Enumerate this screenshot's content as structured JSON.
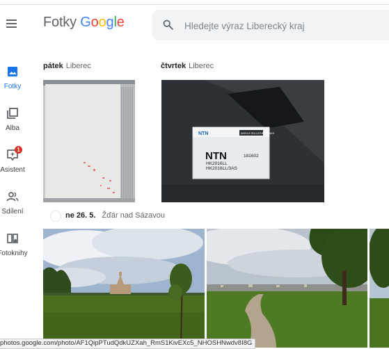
{
  "app": {
    "brand": "Fotky",
    "logo_letters": [
      "G",
      "o",
      "o",
      "g",
      "l",
      "e"
    ]
  },
  "search": {
    "placeholder": "Hledejte výraz Liberecký kraj"
  },
  "sidebar": {
    "items": [
      {
        "label": "Fotky",
        "icon": "photos-icon",
        "active": true
      },
      {
        "label": "Alba",
        "icon": "albums-icon"
      },
      {
        "label": "Asistent",
        "icon": "assistant-icon",
        "badge": "1"
      },
      {
        "label": "Sdílení",
        "icon": "sharing-icon"
      },
      {
        "label": "Fotoknihy",
        "icon": "photobook-icon"
      }
    ]
  },
  "sections": [
    {
      "day": "pátek",
      "place": "Liberec"
    },
    {
      "day": "čtvrtek",
      "place": "Liberec"
    },
    {
      "day": "ne 26. 5.",
      "place": "Žďár nad Sázavou"
    }
  ],
  "photo_text": {
    "box_brand": "NTN",
    "box_code": "181602",
    "box_model_1": "HK2016LL",
    "box_model_2": "HK2016LL/3AS",
    "box_label": "NEEDLE ROLLER BEARINGS"
  },
  "status": {
    "url": "photos.google.com/photo/AF1QipPTudQdkUZXah_RmS1KivEXc5_NHOSHNwdv8I8G"
  },
  "colors": {
    "accent": "#1a73e8",
    "badge": "#d93025",
    "search_bg": "#f1f3f4"
  }
}
